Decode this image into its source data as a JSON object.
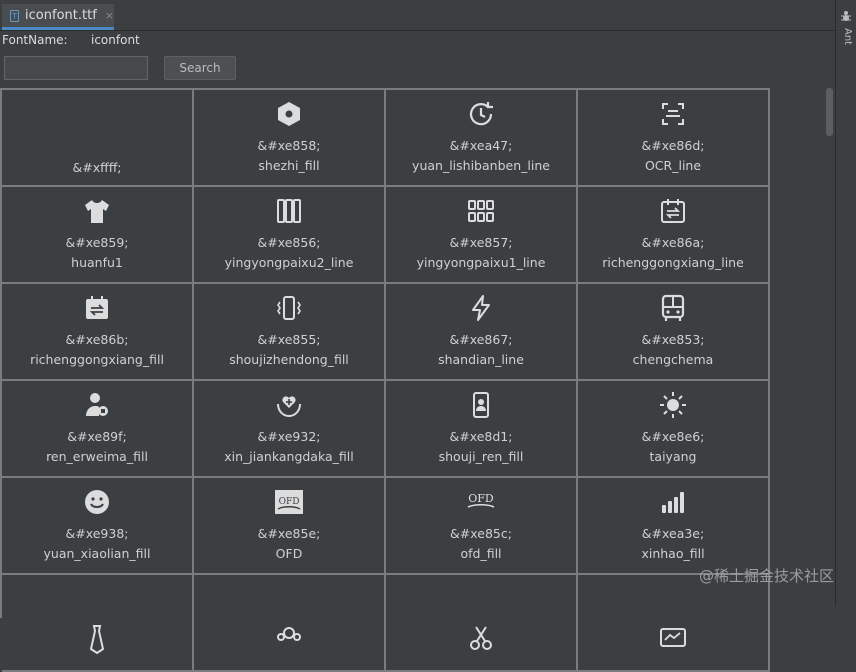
{
  "tab": {
    "title": "iconfont.ttf",
    "close": "×",
    "icon": "font-file-icon"
  },
  "sidebar": {
    "label": "Ant",
    "icon": "ant-icon"
  },
  "font": {
    "label": "FontName:",
    "value": "iconfont"
  },
  "search": {
    "value": "",
    "placeholder": "",
    "button_label": "Search"
  },
  "glyphs": [
    {
      "code": "&#xffff;",
      "name": "",
      "icon": "blank"
    },
    {
      "code": "&#xe858;",
      "name": "shezhi_fill",
      "icon": "hexagon-settings-icon"
    },
    {
      "code": "&#xea47;",
      "name": "yuan_lishibanben_line",
      "icon": "history-clock-icon"
    },
    {
      "code": "&#xe86d;",
      "name": "OCR_line",
      "icon": "ocr-scan-icon"
    },
    {
      "code": "&#xe859;",
      "name": "huanfu1",
      "icon": "tshirt-icon"
    },
    {
      "code": "&#xe856;",
      "name": "yingyongpaixu2_line",
      "icon": "three-columns-icon"
    },
    {
      "code": "&#xe857;",
      "name": "yingyongpaixu1_line",
      "icon": "six-grid-icon"
    },
    {
      "code": "&#xe86a;",
      "name": "richenggongxiang_line",
      "icon": "calendar-share-icon"
    },
    {
      "code": "&#xe86b;",
      "name": "richenggongxiang_fill",
      "icon": "calendar-share-fill-icon"
    },
    {
      "code": "&#xe855;",
      "name": "shoujizhendong_fill",
      "icon": "phone-vibrate-icon"
    },
    {
      "code": "&#xe867;",
      "name": "shandian_line",
      "icon": "lightning-icon"
    },
    {
      "code": "&#xe853;",
      "name": "chengchema",
      "icon": "bus-icon"
    },
    {
      "code": "&#xe89f;",
      "name": "ren_erweima_fill",
      "icon": "person-badge-icon"
    },
    {
      "code": "&#xe932;",
      "name": "xin_jiankangdaka_fill",
      "icon": "heart-hands-icon"
    },
    {
      "code": "&#xe8d1;",
      "name": "shouji_ren_fill",
      "icon": "phone-person-icon"
    },
    {
      "code": "&#xe8e6;",
      "name": "taiyang",
      "icon": "sun-icon"
    },
    {
      "code": "&#xe938;",
      "name": "yuan_xiaolian_fill",
      "icon": "smiley-icon"
    },
    {
      "code": "&#xe85e;",
      "name": "OFD",
      "icon": "ofd-box-icon"
    },
    {
      "code": "&#xe85c;",
      "name": "ofd_fill",
      "icon": "ofd-text-icon"
    },
    {
      "code": "&#xea3e;",
      "name": "xinhao_fill",
      "icon": "signal-bars-icon"
    },
    {
      "code": "",
      "name": "",
      "icon": "tie-icon"
    },
    {
      "code": "",
      "name": "",
      "icon": "group-icon"
    },
    {
      "code": "",
      "name": "",
      "icon": "scissors-icon"
    },
    {
      "code": "",
      "name": "",
      "icon": "monitor-icon"
    }
  ],
  "watermark": "@稀土掘金技术社区",
  "colors": {
    "background": "#3c3f41",
    "grid": "#7c7c7c",
    "accent": "#4a88c7",
    "glyph": "#dcdcdc"
  }
}
